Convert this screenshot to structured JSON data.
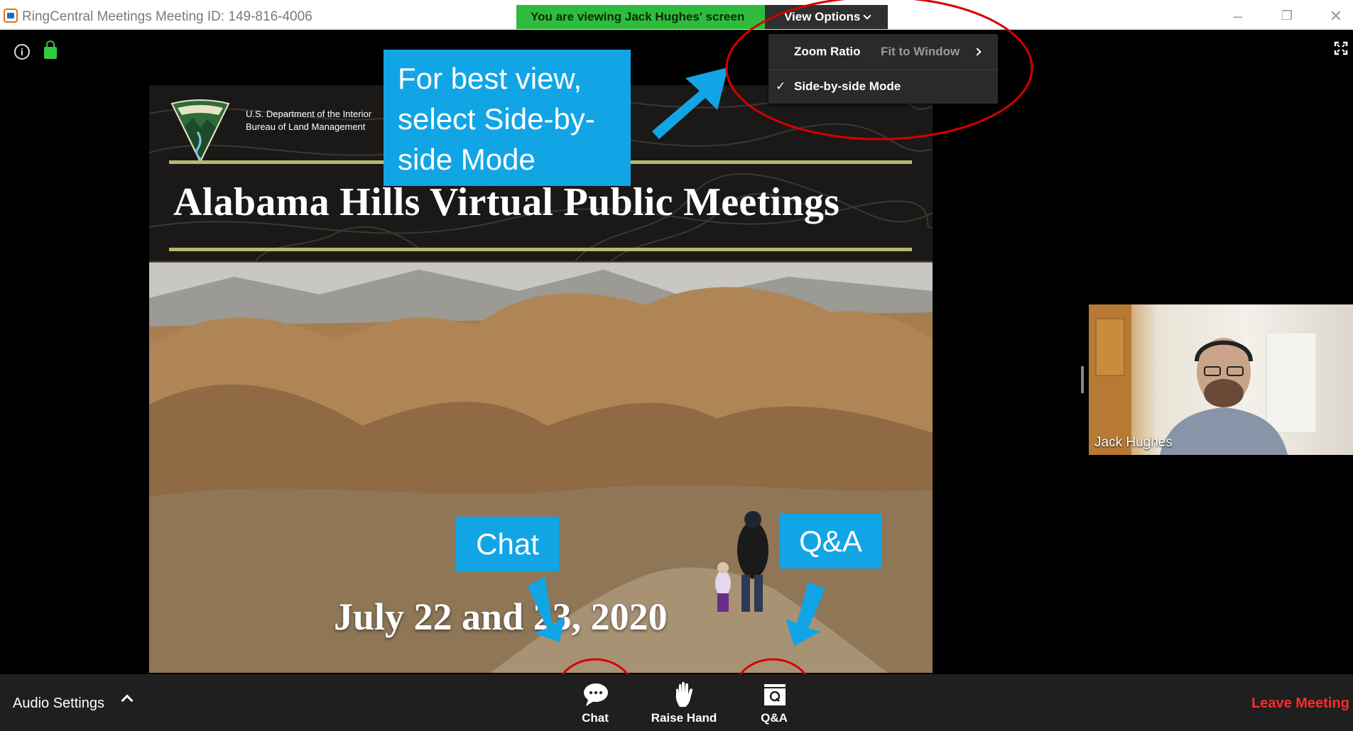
{
  "window": {
    "title": "RingCentral Meetings Meeting ID: 149-816-4006",
    "viewing_banner": "You are viewing Jack Hughes' screen",
    "view_options_label": "View Options"
  },
  "view_menu": {
    "zoom_ratio_label": "Zoom Ratio",
    "zoom_ratio_value": "Fit to Window",
    "side_by_side_label": "Side-by-side Mode",
    "side_by_side_checked": true
  },
  "slide": {
    "agency_line1": "U.S. Department of the Interior",
    "agency_line2": "Bureau of Land Management",
    "title": "Alabama Hills Virtual Public Meetings",
    "date": "July 22 and 23, 2020"
  },
  "callouts": {
    "best_view": "For best view, select Side-by-side Mode",
    "chat": "Chat",
    "qa": "Q&A"
  },
  "participant": {
    "name": "Jack Hughes"
  },
  "toolbar": {
    "audio_settings": "Audio Settings",
    "chat": "Chat",
    "raise_hand": "Raise Hand",
    "qa": "Q&A",
    "leave": "Leave Meeting"
  },
  "colors": {
    "banner_green": "#2fbc3d",
    "callout_blue": "#12a5e5",
    "annotation_red": "#d40000",
    "leave_red": "#ff2b2b"
  }
}
